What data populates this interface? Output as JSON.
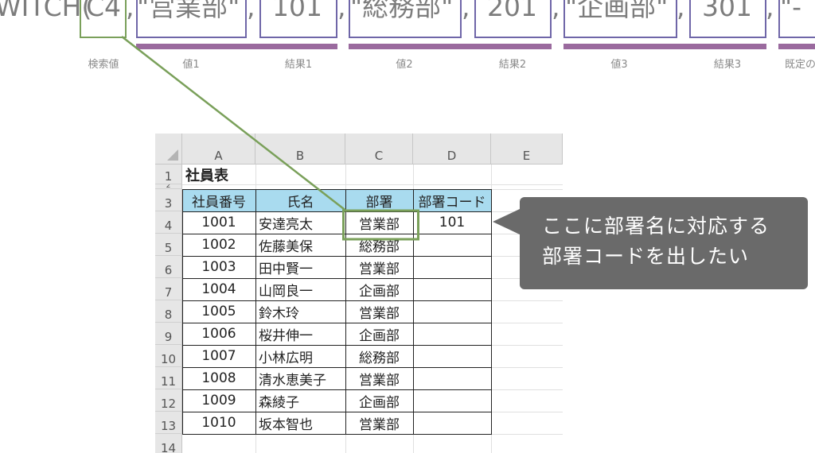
{
  "formula": {
    "segments": [
      {
        "text": "WITCH(",
        "kind": "plain"
      },
      {
        "text": "C4",
        "kind": "green-box"
      },
      {
        "text": ",",
        "kind": "plain"
      },
      {
        "text": "\"営業部\"",
        "kind": "box"
      },
      {
        "text": ",",
        "kind": "plain"
      },
      {
        "text": "101",
        "kind": "box"
      },
      {
        "text": ",",
        "kind": "plain"
      },
      {
        "text": "\"総務部\"",
        "kind": "box"
      },
      {
        "text": ",",
        "kind": "plain"
      },
      {
        "text": "201",
        "kind": "box"
      },
      {
        "text": ",",
        "kind": "plain"
      },
      {
        "text": "\"企画部\"",
        "kind": "box"
      },
      {
        "text": ",",
        "kind": "plain"
      },
      {
        "text": "301",
        "kind": "box"
      },
      {
        "text": ",",
        "kind": "plain"
      },
      {
        "text": "\"-",
        "kind": "box"
      }
    ],
    "labels": [
      "検索値",
      "値1",
      "結果1",
      "値2",
      "結果2",
      "値3",
      "結果3",
      "既定の"
    ]
  },
  "sheet": {
    "columns": [
      "A",
      "B",
      "C",
      "D",
      "E"
    ],
    "row_numbers": [
      "1",
      "2",
      "3",
      "4",
      "5",
      "6",
      "7",
      "8",
      "9",
      "10",
      "11",
      "12",
      "13",
      "14"
    ],
    "title": "社員表",
    "headers": [
      "社員番号",
      "氏名",
      "部署",
      "部署コード"
    ],
    "rows": [
      {
        "id": "1001",
        "name": "安達亮太",
        "dept": "営業部",
        "code": "101"
      },
      {
        "id": "1002",
        "name": "佐藤美保",
        "dept": "総務部",
        "code": ""
      },
      {
        "id": "1003",
        "name": "田中賢一",
        "dept": "営業部",
        "code": ""
      },
      {
        "id": "1004",
        "name": "山岡良一",
        "dept": "企画部",
        "code": ""
      },
      {
        "id": "1005",
        "name": "鈴木玲",
        "dept": "営業部",
        "code": ""
      },
      {
        "id": "1006",
        "name": "桜井伸一",
        "dept": "企画部",
        "code": ""
      },
      {
        "id": "1007",
        "name": "小林広明",
        "dept": "総務部",
        "code": ""
      },
      {
        "id": "1008",
        "name": "清水恵美子",
        "dept": "営業部",
        "code": ""
      },
      {
        "id": "1009",
        "name": "森綾子",
        "dept": "企画部",
        "code": ""
      },
      {
        "id": "1010",
        "name": "坂本智也",
        "dept": "営業部",
        "code": ""
      }
    ]
  },
  "callout": {
    "line1": "ここに部署名に対応する",
    "line2": "部署コードを出したい"
  },
  "colors": {
    "box_border": "#6f66a8",
    "green_highlight": "#7aa05a",
    "bracket_bar": "#9a6a9e",
    "header_fill": "#a9dbef",
    "callout_fill": "#6a6a6a"
  }
}
